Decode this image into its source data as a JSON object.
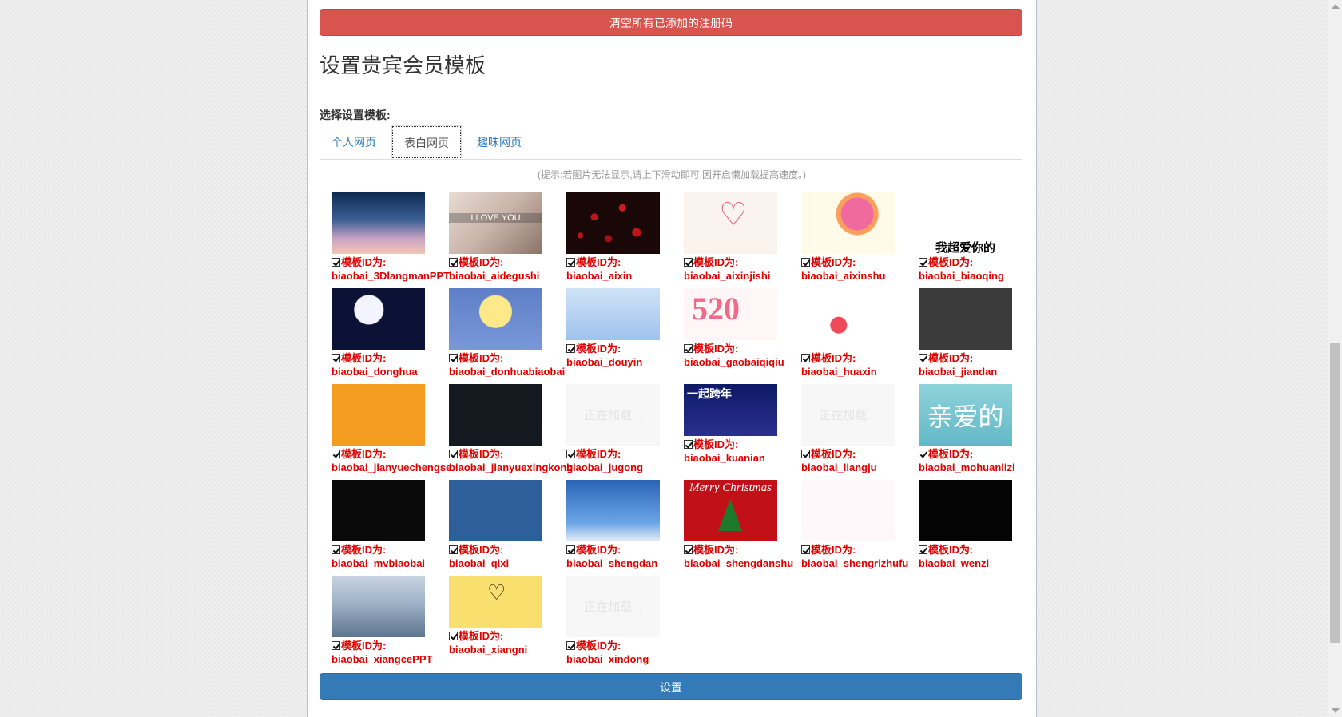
{
  "actions": {
    "clear_button": "清空所有已添加的注册码",
    "submit_button": "设置"
  },
  "page": {
    "title": "设置贵宾会员模板",
    "select_label": "选择设置模板:",
    "hint": "(提示:若图片无法显示,请上下滑动即可,因开启懒加载提高速度。)"
  },
  "tabs": [
    {
      "label": "个人网页",
      "active": false
    },
    {
      "label": "表白网页",
      "active": true
    },
    {
      "label": "趣味网页",
      "active": false
    }
  ],
  "template_prefix": "模板ID为:",
  "templates": [
    {
      "id": "biaobai_3DlangmanPPT",
      "thumb": "night-sky",
      "checked": true
    },
    {
      "id": "biaobai_aidegushi",
      "thumb": "photo-i-love-you",
      "overlay": "I LOVE YOU",
      "checked": true
    },
    {
      "id": "biaobai_aixin",
      "thumb": "red-hearts-dark",
      "checked": true
    },
    {
      "id": "biaobai_aixinjishi",
      "thumb": "heart-outline",
      "checked": true
    },
    {
      "id": "biaobai_aixinshu",
      "thumb": "heart-tree",
      "checked": true
    },
    {
      "id": "biaobai_biaoqing",
      "thumb": "cartoon-love",
      "overlay": "我超爱你的",
      "checked": true
    },
    {
      "id": "biaobai_donghua",
      "thumb": "couple-heart-night",
      "checked": true
    },
    {
      "id": "biaobai_donhuabiaobai",
      "thumb": "moon-couple",
      "checked": true
    },
    {
      "id": "biaobai_douyin",
      "thumb": "anime-girl",
      "checked": true
    },
    {
      "id": "biaobai_gaobaiqiqiu",
      "thumb": "520-balloons",
      "overlay": "520",
      "checked": true
    },
    {
      "id": "biaobai_huaxin",
      "thumb": "falling-hearts",
      "checked": true
    },
    {
      "id": "biaobai_jiandan",
      "thumb": "dark-menu",
      "checked": true
    },
    {
      "id": "biaobai_jianyuechengse",
      "thumb": "orange",
      "checked": true
    },
    {
      "id": "biaobai_jianyuexingkong",
      "thumb": "starry-sky",
      "checked": true
    },
    {
      "id": "biaobai_jugong",
      "thumb": "loading",
      "overlay": "正在加载...",
      "checked": true
    },
    {
      "id": "biaobai_kuanian",
      "thumb": "new-year",
      "overlay": "一起跨年",
      "checked": true
    },
    {
      "id": "biaobai_liangju",
      "thumb": "loading",
      "overlay": "正在加载...",
      "checked": true
    },
    {
      "id": "biaobai_mohuanlizi",
      "thumb": "teal-text",
      "overlay": "亲爱的",
      "checked": true
    },
    {
      "id": "biaobai_mvbiaobai",
      "thumb": "black-mv",
      "checked": true
    },
    {
      "id": "biaobai_qixi",
      "thumb": "blue-qixi",
      "checked": true
    },
    {
      "id": "biaobai_shengdan",
      "thumb": "snow-night",
      "checked": true
    },
    {
      "id": "biaobai_shengdanshu",
      "thumb": "christmas-tree",
      "overlay": "Merry Christmas",
      "checked": true
    },
    {
      "id": "biaobai_shengrizhufu",
      "thumb": "birthday-cake",
      "checked": true
    },
    {
      "id": "biaobai_wenzi",
      "thumb": "black-text",
      "checked": true
    },
    {
      "id": "biaobai_xiangcePPT",
      "thumb": "misty-mountains",
      "checked": true
    },
    {
      "id": "biaobai_xiangni",
      "thumb": "yellow-hand-heart",
      "checked": true
    },
    {
      "id": "biaobai_xindong",
      "thumb": "loading",
      "overlay": "正在加载...",
      "checked": true
    }
  ],
  "colors": {
    "danger": "#d9534f",
    "primary": "#337ab7",
    "template_id_text": "#e00000"
  }
}
